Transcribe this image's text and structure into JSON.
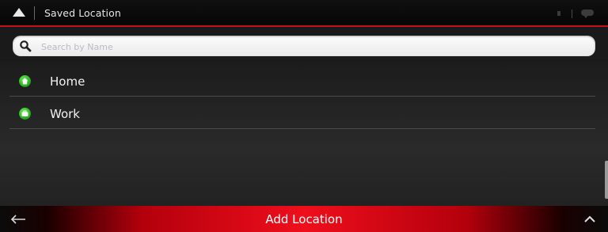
{
  "header": {
    "title": "Saved Location"
  },
  "search": {
    "placeholder": "Search by Name",
    "value": ""
  },
  "locations": [
    {
      "label": "Home",
      "icon": "home-icon"
    },
    {
      "label": "Work",
      "icon": "briefcase-icon"
    }
  ],
  "footer": {
    "primary_action": "Add Location"
  },
  "colors": {
    "accent": "#e50d1b",
    "pin_green": "#2fbf2a"
  }
}
